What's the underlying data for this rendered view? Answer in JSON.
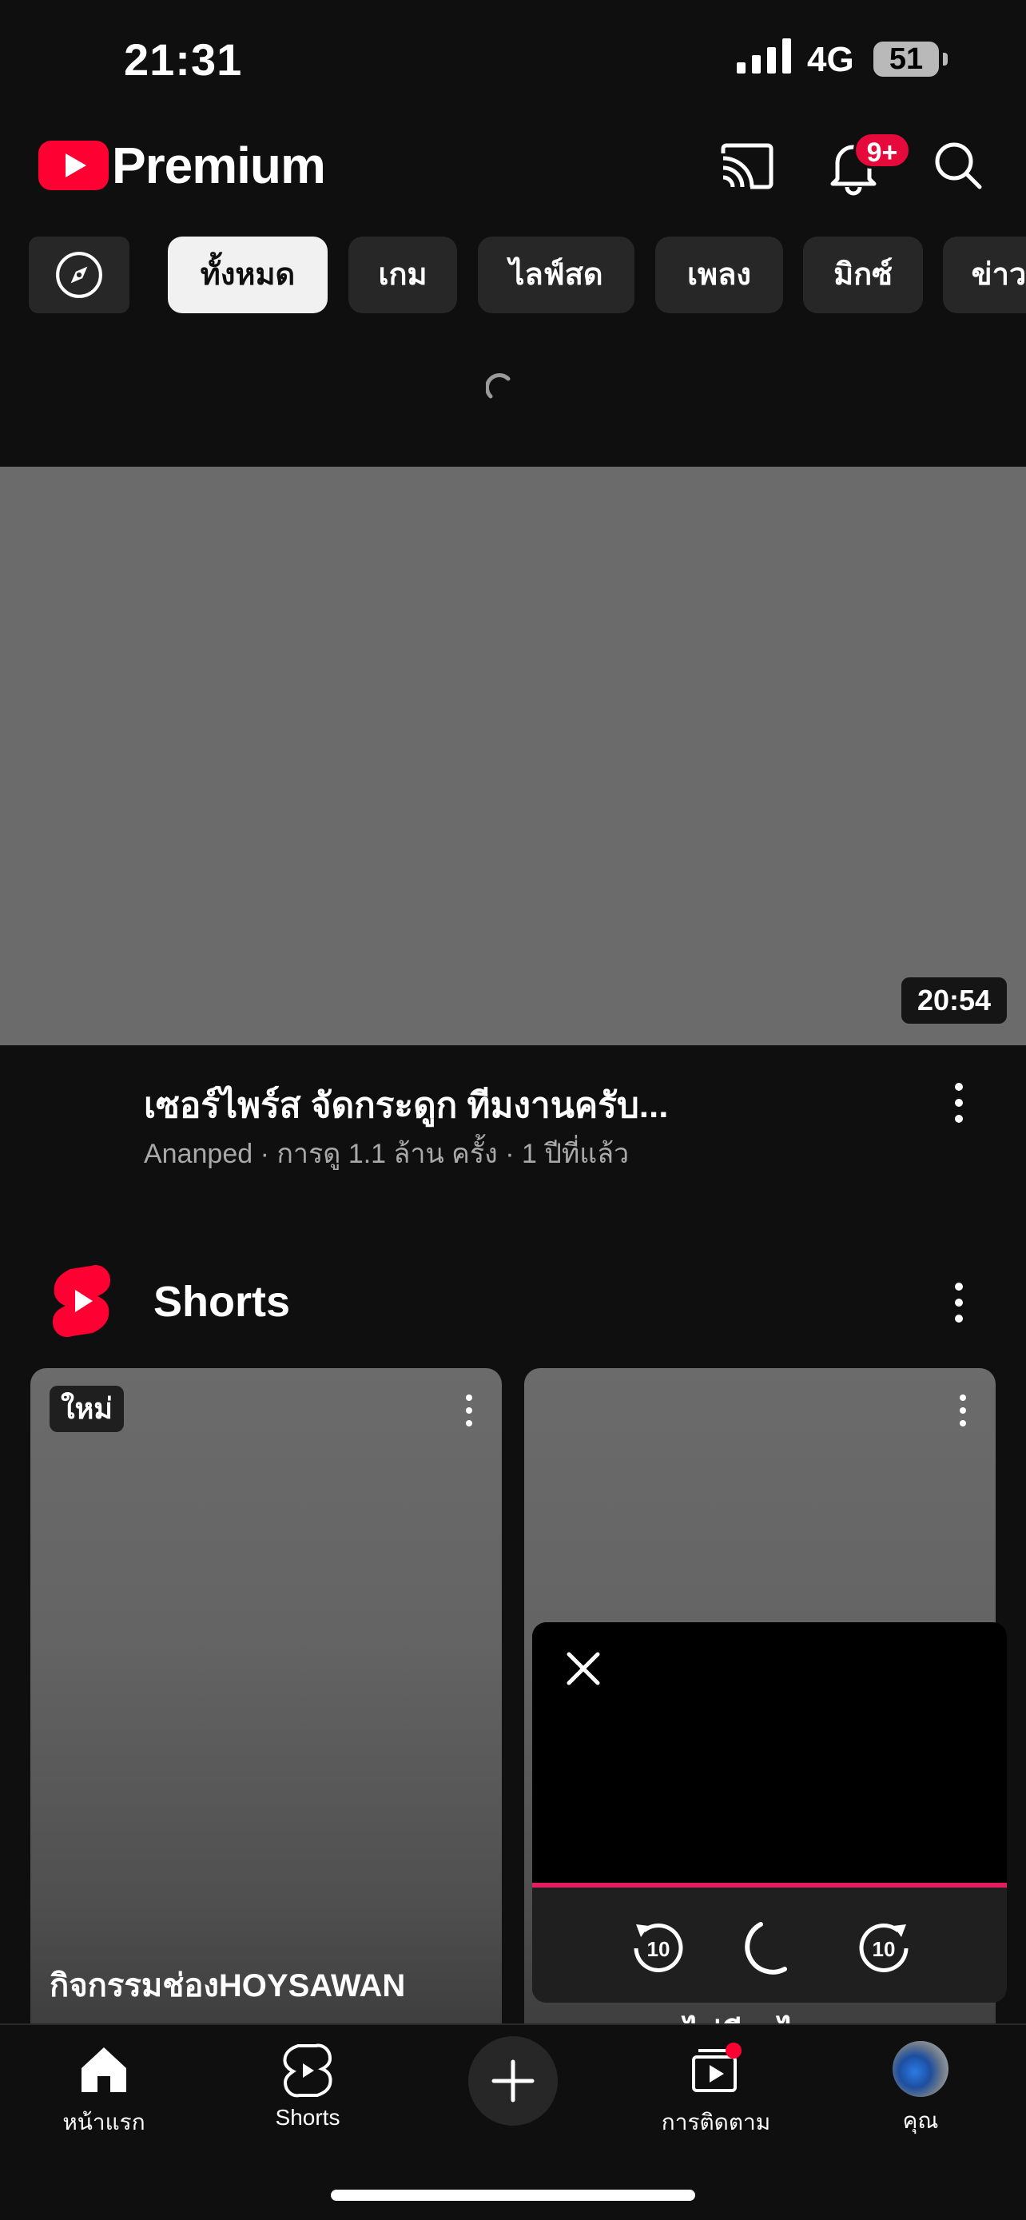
{
  "status_bar": {
    "time": "21:31",
    "network": "4G",
    "battery": "51"
  },
  "header": {
    "brand": "Premium",
    "notification_badge": "9+"
  },
  "chips": [
    "ทั้งหมด",
    "เกม",
    "ไลฟ์สด",
    "เพลง",
    "มิกซ์",
    "ข่าว"
  ],
  "video": {
    "duration": "20:54",
    "title": "เซอร์ไพร์ส จัดกระดูก ทีมงานครับ...",
    "meta": "Ananped · การดู 1.1 ล้าน ครั้ง · 1 ปีที่แล้ว"
  },
  "shorts": {
    "title": "Shorts",
    "cards": [
      {
        "badge": "ใหม่",
        "caption": "กิจกรรมช่องHOYSAWAN"
      },
      {
        "caption": "ไม่มีอะไร"
      }
    ]
  },
  "bottom_nav": {
    "home": "หน้าแรก",
    "shorts": "Shorts",
    "subscriptions": "การติดตาม",
    "you": "คุณ"
  },
  "colors": {
    "accent": "#e5093c",
    "background": "#0f0f0f",
    "chip": "#272727",
    "progress": "#e11d5f"
  },
  "icons": [
    "signal-icon",
    "youtube-logo-icon",
    "cast-icon",
    "bell-icon",
    "search-icon",
    "compass-icon",
    "more-vertical-icon",
    "shorts-logo-icon",
    "close-icon",
    "rewind-10-icon",
    "loading-icon",
    "forward-10-icon",
    "home-icon",
    "shorts-icon",
    "plus-icon",
    "subscriptions-icon",
    "avatar"
  ]
}
